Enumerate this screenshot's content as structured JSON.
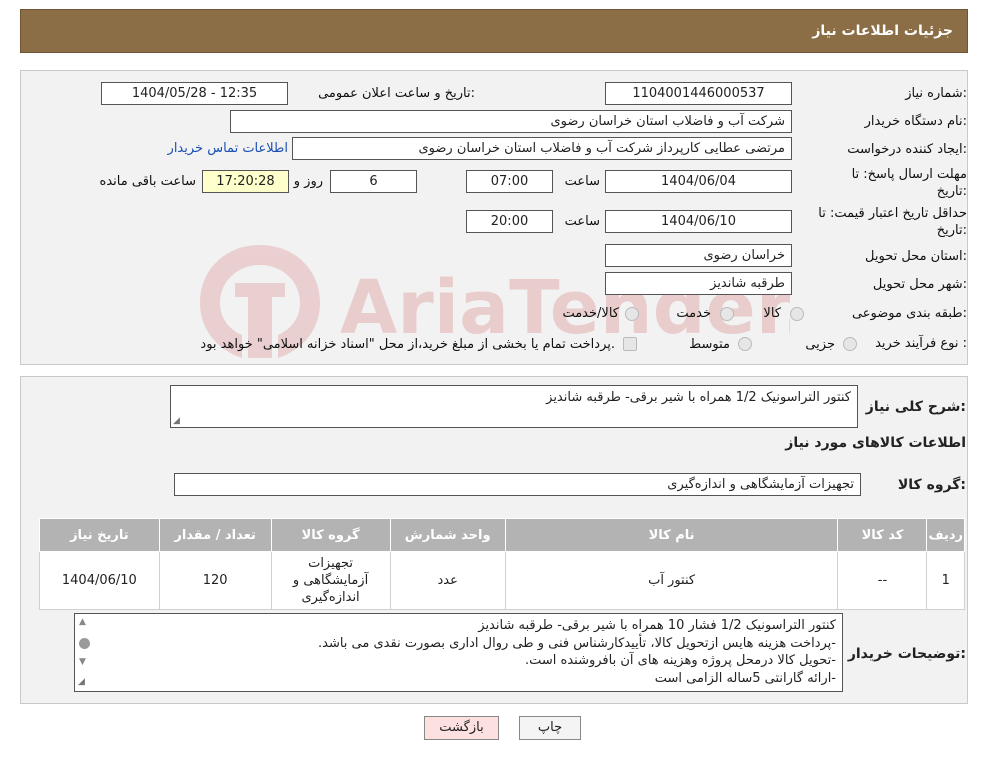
{
  "header": {
    "title": "جزئیات اطلاعات نیاز"
  },
  "watermark": {
    "text": "AriaTender.neT"
  },
  "form": {
    "need_number_label": "شماره نیاز:",
    "need_number": "1104001446000537",
    "announce_label": "تاریخ و ساعت اعلان عمومی:",
    "announce_value": "1404/05/28 - 12:35",
    "buyer_org_label": "نام دستگاه خریدار:",
    "buyer_org": "شرکت آب و فاضلاب استان خراسان رضوی",
    "creator_label": "ایجاد کننده درخواست:",
    "creator": "مرتضی عطایی کارپرداز شرکت آب و فاضلاب استان خراسان رضوی",
    "contact_link": "اطلاعات تماس خریدار",
    "deadline_label_1": "مهلت ارسال پاسخ: تا",
    "deadline_label_2": "تاریخ:",
    "deadline_date": "1404/06/04",
    "time_label": "ساعت",
    "deadline_time": "07:00",
    "days_value": "6",
    "days_label": "روز و",
    "remaining_time": "17:20:28",
    "remaining_label": "ساعت باقی مانده",
    "validity_label_1": "حداقل تاریخ اعتبار قیمت: تا",
    "validity_label_2": "تاریخ:",
    "validity_date": "1404/06/10",
    "validity_time": "20:00",
    "province_label": "استان محل تحویل:",
    "province": "خراسان رضوی",
    "city_label": "شهر محل تحویل:",
    "city": "طرقبه شاندیز",
    "category_label": "طبقه بندی موضوعی:",
    "category_options": [
      "کالا",
      "خدمت",
      "کالا/خدمت"
    ],
    "process_label": "نوع فرآیند خرید :",
    "process_options": [
      "جزیی",
      "متوسط"
    ],
    "process_note": "پرداخت تمام یا بخشی از مبلغ خرید،از محل \"اسناد خزانه اسلامی\" خواهد بود."
  },
  "summary": {
    "label": "شرح کلی نیاز:",
    "value": "کنتور التراسونیک 1/2 همراه با شیر برقی- طرقبه شاندیز"
  },
  "items_section": {
    "title": "اطلاعات کالاهای مورد نیاز",
    "group_label": "گروه کالا:",
    "group_value": "تجهیزات آزمایشگاهی و اندازه‌گیری"
  },
  "table": {
    "headers": [
      "ردیف",
      "کد کالا",
      "نام کالا",
      "واحد شمارش",
      "گروه کالا",
      "تعداد / مقدار",
      "تاریخ نیاز"
    ],
    "rows": [
      {
        "row": "1",
        "code": "--",
        "name": "کنتور آب",
        "unit": "عدد",
        "group": "تجهیزات آزمایشگاهی و اندازه‌گیری",
        "qty": "120",
        "date": "1404/06/10"
      }
    ]
  },
  "buyer_notes": {
    "label": "توضیحات خریدار:",
    "lines": [
      "کنتور التراسونیک 1/2 فشار 10 همراه با شیر برقی- طرقبه شاندیز",
      "-پرداخت هزینه هایس ازتحویل کالا، تأییدکارشناس فنی و طی روال اداری بصورت نقدی می باشد.",
      "-تحویل کالا درمحل پروژه وهزینه های آن بافروشنده است.",
      "-ارائه گارانتی 5ساله الزامی است"
    ]
  },
  "buttons": {
    "print": "چاپ",
    "back": "بازگشت"
  }
}
